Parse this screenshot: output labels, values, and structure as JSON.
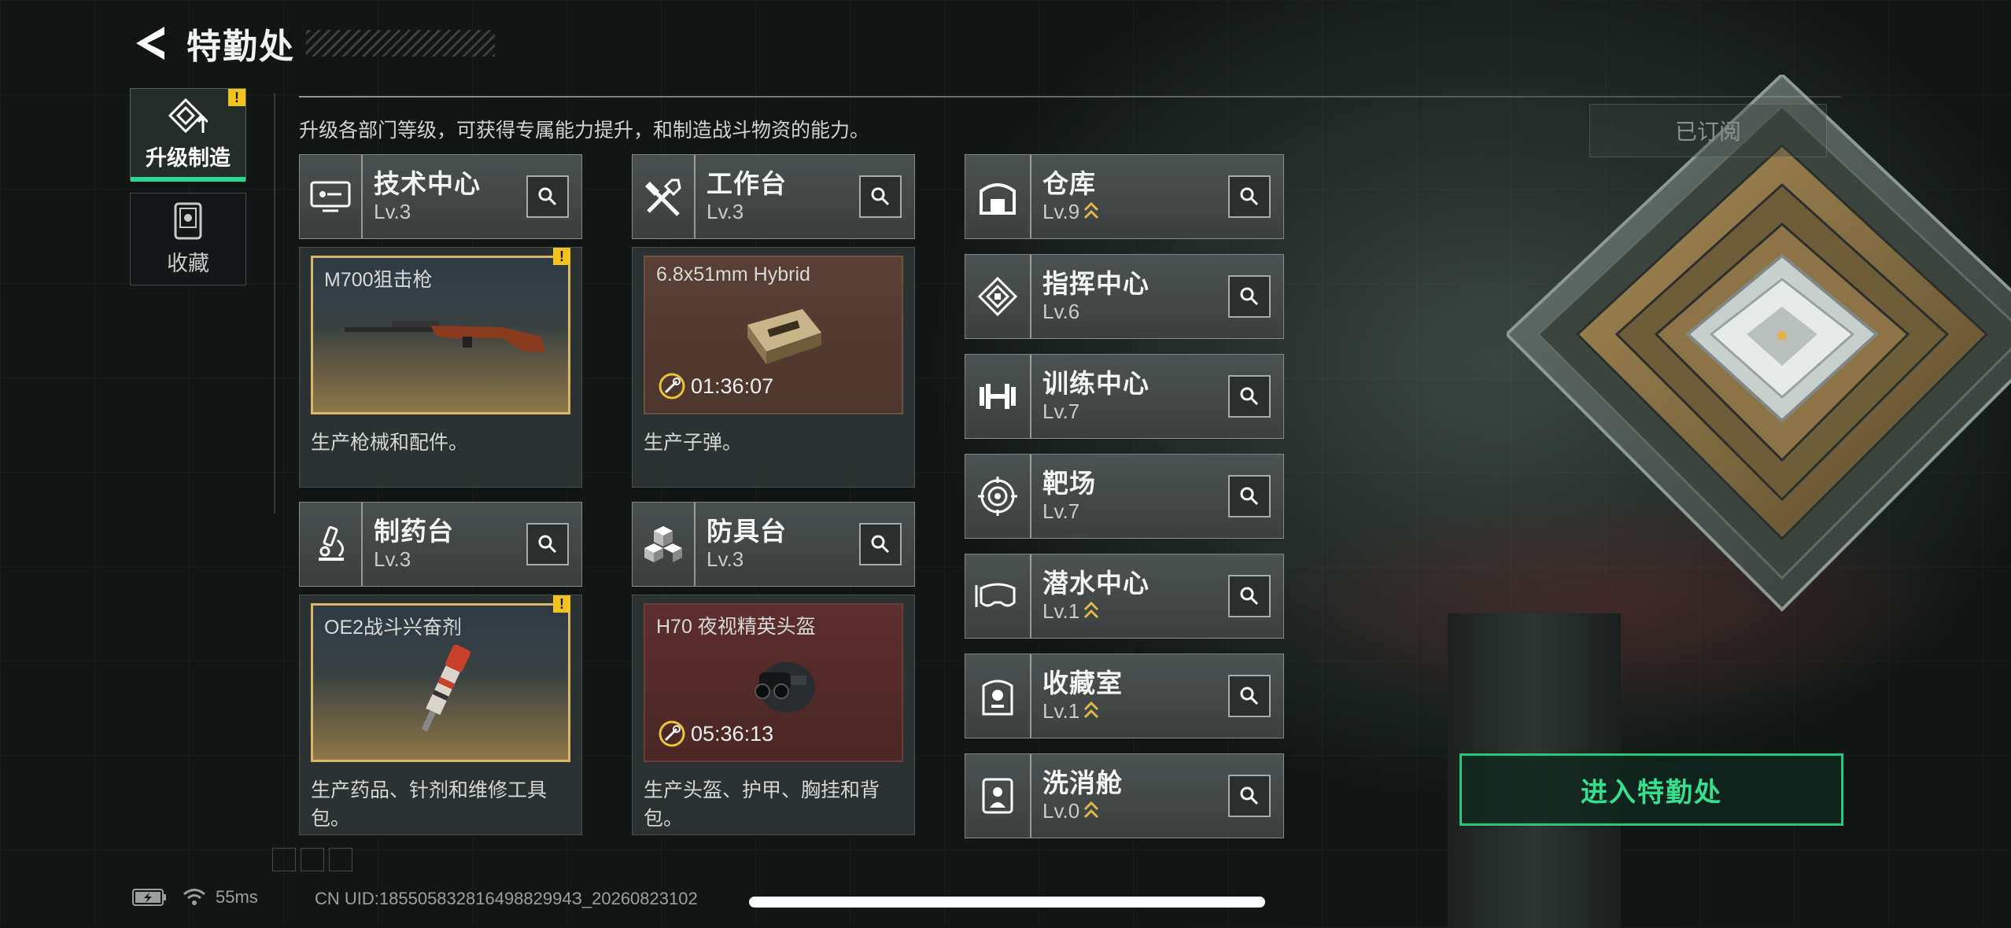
{
  "header": {
    "title": "特勤处"
  },
  "sidenav": {
    "items": [
      {
        "label": "升级制造",
        "active": true,
        "warn": "!"
      },
      {
        "label": "收藏",
        "active": false
      }
    ]
  },
  "description": "升级各部门等级，可获得专属能力提升，和制造战斗物资的能力。",
  "subscribe_label": "已订阅",
  "cards": [
    {
      "name": "技术中心",
      "level": "Lv.3",
      "product": "M700狙击枪",
      "timer": "",
      "desc": "生产枪械和配件。",
      "warn": "!"
    },
    {
      "name": "工作台",
      "level": "Lv.3",
      "product": "6.8x51mm Hybrid",
      "timer": "01:36:07",
      "desc": "生产子弹。"
    },
    {
      "name": "制药台",
      "level": "Lv.3",
      "product": "OE2战斗兴奋剂",
      "timer": "",
      "desc": "生产药品、针剂和维修工具包。",
      "warn": "!"
    },
    {
      "name": "防具台",
      "level": "Lv.3",
      "product": "H70 夜视精英头盔",
      "timer": "05:36:13",
      "desc": "生产头盔、护甲、胸挂和背包。"
    }
  ],
  "facilities": [
    {
      "name": "仓库",
      "level": "Lv.9",
      "upgradable": true
    },
    {
      "name": "指挥中心",
      "level": "Lv.6",
      "upgradable": false
    },
    {
      "name": "训练中心",
      "level": "Lv.7",
      "upgradable": false
    },
    {
      "name": "靶场",
      "level": "Lv.7",
      "upgradable": false
    },
    {
      "name": "潜水中心",
      "level": "Lv.1",
      "upgradable": true
    },
    {
      "name": "收藏室",
      "level": "Lv.1",
      "upgradable": true
    },
    {
      "name": "洗消舱",
      "level": "Lv.0",
      "upgradable": true
    }
  ],
  "enter_button": "进入特勤处",
  "footer": {
    "ping": "55ms",
    "uid": "CN UID:18550583281649882994З_20260823102"
  },
  "colors": {
    "accent": "#27d98c",
    "gold": "#d9b767",
    "warning": "#f2c21d"
  }
}
